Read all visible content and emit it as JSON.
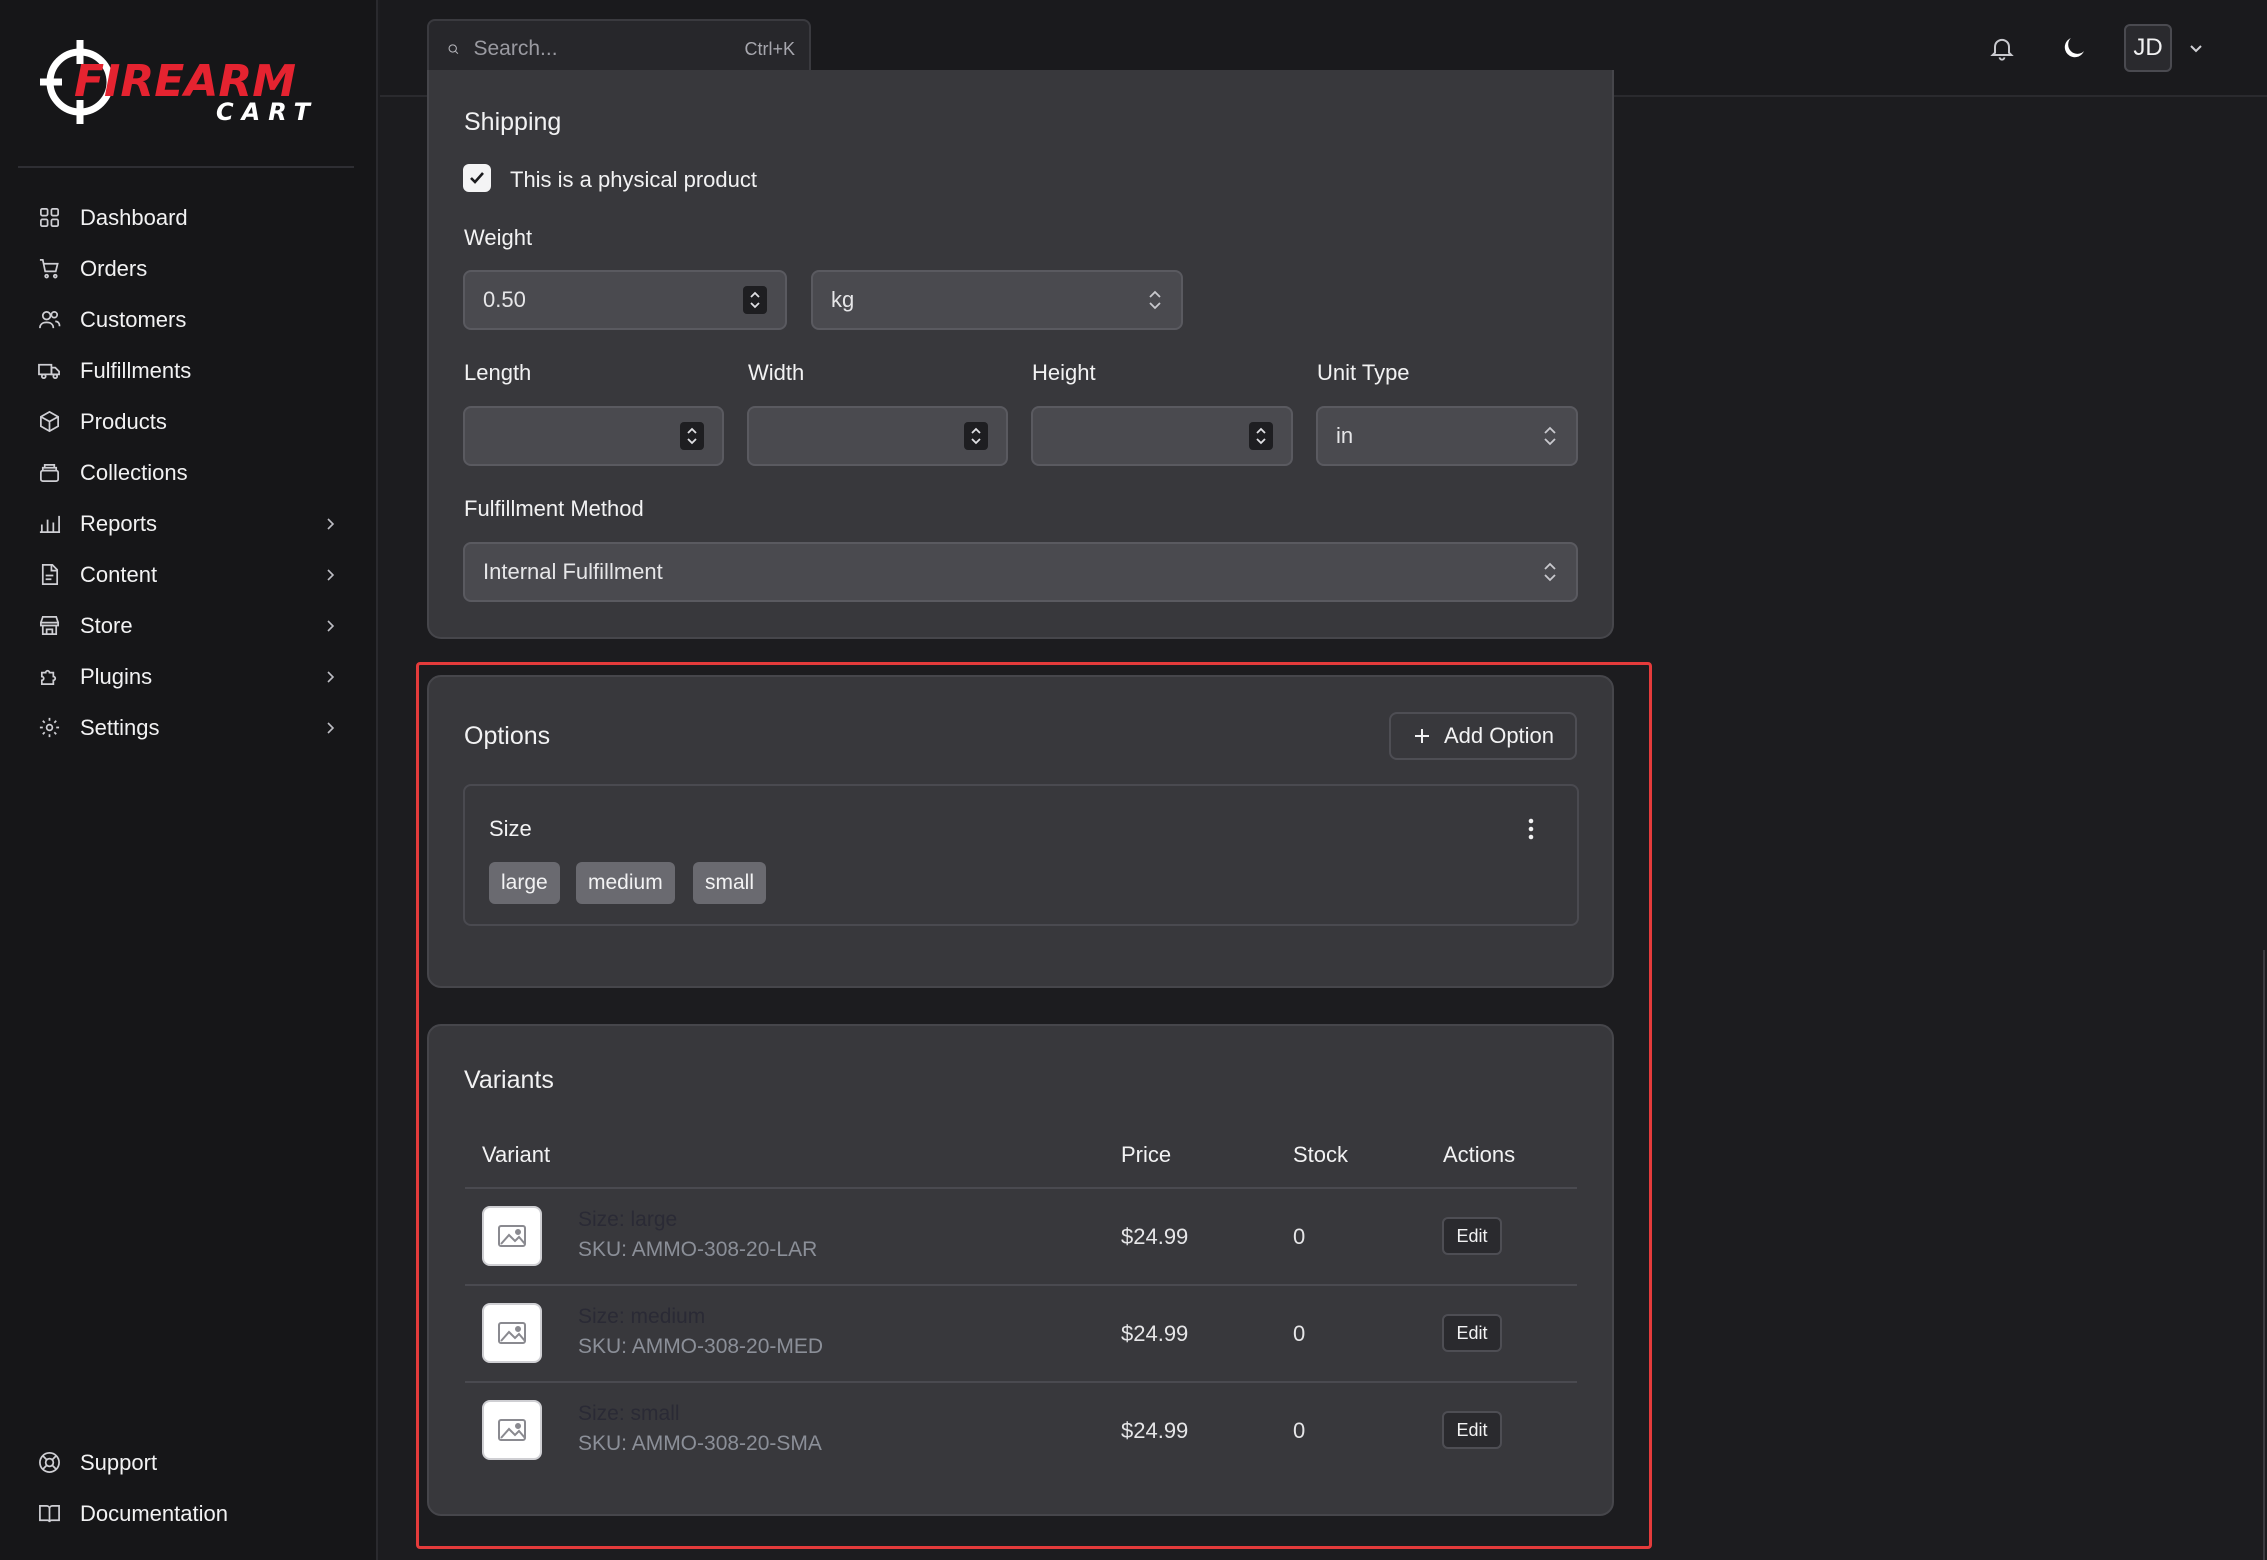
{
  "brand": {
    "logo_word_top": "FIREARM",
    "logo_word_bottom": "CART",
    "accent": "#e52330"
  },
  "search": {
    "placeholder": "Search...",
    "shortcut": "Ctrl+K"
  },
  "user": {
    "initials": "JD"
  },
  "sidebar": {
    "items": [
      {
        "label": "Dashboard",
        "icon": "grid-icon"
      },
      {
        "label": "Orders",
        "icon": "cart-icon"
      },
      {
        "label": "Customers",
        "icon": "users-icon"
      },
      {
        "label": "Fulfillments",
        "icon": "truck-icon"
      },
      {
        "label": "Products",
        "icon": "box-icon"
      },
      {
        "label": "Collections",
        "icon": "layers-icon"
      },
      {
        "label": "Reports",
        "icon": "chart-icon",
        "expandable": true
      },
      {
        "label": "Content",
        "icon": "file-icon",
        "expandable": true
      },
      {
        "label": "Store",
        "icon": "store-icon",
        "expandable": true
      },
      {
        "label": "Plugins",
        "icon": "puzzle-icon",
        "expandable": true
      },
      {
        "label": "Settings",
        "icon": "gear-icon",
        "expandable": true
      }
    ],
    "bottom": [
      {
        "label": "Support",
        "icon": "lifebuoy-icon"
      },
      {
        "label": "Documentation",
        "icon": "book-icon"
      }
    ]
  },
  "shipping": {
    "title": "Shipping",
    "physical_label": "This is a physical product",
    "physical_checked": true,
    "weight_label": "Weight",
    "weight_value": "0.50",
    "weight_unit": "kg",
    "length_label": "Length",
    "width_label": "Width",
    "height_label": "Height",
    "unit_type_label": "Unit Type",
    "unit_type_value": "in",
    "fulfillment_label": "Fulfillment Method",
    "fulfillment_value": "Internal Fulfillment"
  },
  "options": {
    "title": "Options",
    "add_label": "Add Option",
    "option_name": "Size",
    "values": [
      "large",
      "medium",
      "small"
    ]
  },
  "variants": {
    "title": "Variants",
    "columns": {
      "variant": "Variant",
      "price": "Price",
      "stock": "Stock",
      "actions": "Actions"
    },
    "rows": [
      {
        "name": "Size: large",
        "sku": "SKU: AMMO-308-20-LAR",
        "price": "$24.99",
        "stock": "0",
        "action": "Edit"
      },
      {
        "name": "Size: medium",
        "sku": "SKU: AMMO-308-20-MED",
        "price": "$24.99",
        "stock": "0",
        "action": "Edit"
      },
      {
        "name": "Size: small",
        "sku": "SKU: AMMO-308-20-SMA",
        "price": "$24.99",
        "stock": "0",
        "action": "Edit"
      }
    ]
  }
}
